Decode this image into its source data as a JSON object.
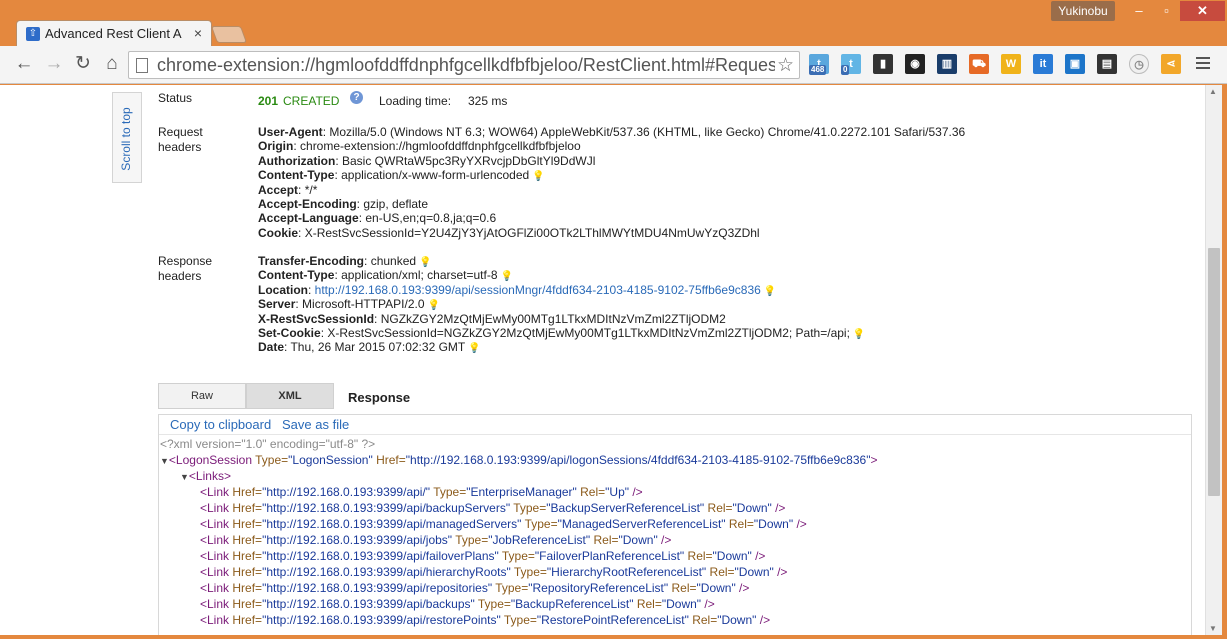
{
  "window": {
    "user": "Yukinobu"
  },
  "tab": {
    "title": "Advanced Rest Client A"
  },
  "toolbar": {
    "url": "chrome-extension://hgmloofddffdnphfgcellkdfbfbjeloo/RestClient.html#Reques",
    "extensions": [
      {
        "icon": "twitter-bird-icon",
        "badge": "468",
        "color": "#5aa7dd"
      },
      {
        "icon": "twitter-bird-icon",
        "badge": "0",
        "color": "#62b5e5"
      },
      {
        "icon": "phone-send-icon",
        "badge": "",
        "color": "#333333"
      },
      {
        "icon": "color-wheel-icon",
        "badge": "",
        "color": "#222222"
      },
      {
        "icon": "bar-chart-icon",
        "badge": "",
        "color": "#1a3d6a"
      },
      {
        "icon": "shopping-cart-icon",
        "badge": "",
        "color": "#e66a26"
      },
      {
        "icon": "w-icon",
        "badge": "",
        "color": "#f0b31a"
      },
      {
        "icon": "it-icon",
        "badge": "",
        "color": "#2a7bd6"
      },
      {
        "icon": "screen-icon",
        "badge": "",
        "color": "#1d75c9"
      },
      {
        "icon": "film-icon",
        "badge": "",
        "color": "#333333"
      },
      {
        "icon": "clock-icon",
        "badge": "",
        "color": "#cccccc"
      },
      {
        "icon": "share-icon",
        "badge": "",
        "color": "#f2a72a"
      }
    ]
  },
  "page": {
    "scroll_to_top": "Scroll to top",
    "status_label": "Status",
    "status_code": "201",
    "status_text": "CREATED",
    "loading_label": "Loading time:",
    "loading_value": "325 ms",
    "request_headers_label": "Request headers",
    "request_headers": [
      {
        "name": "User-Agent",
        "value": "Mozilla/5.0 (Windows NT 6.3; WOW64) AppleWebKit/537.36 (KHTML, like Gecko) Chrome/41.0.2272.101 Safari/537.36",
        "hint": false
      },
      {
        "name": "Origin",
        "value": "chrome-extension://hgmloofddffdnphfgcellkdfbfbjeloo",
        "hint": false
      },
      {
        "name": "Authorization",
        "value": "Basic QWRtaW5pc3RyYXRvcjpDbGltYl9DdWJl",
        "hint": false
      },
      {
        "name": "Content-Type",
        "value": "application/x-www-form-urlencoded",
        "hint": true
      },
      {
        "name": "Accept",
        "value": "*/*",
        "hint": false
      },
      {
        "name": "Accept-Encoding",
        "value": "gzip, deflate",
        "hint": false
      },
      {
        "name": "Accept-Language",
        "value": "en-US,en;q=0.8,ja;q=0.6",
        "hint": false
      },
      {
        "name": "Cookie",
        "value": "X-RestSvcSessionId=Y2U4ZjY3YjAtOGFlZi00OTk2LThlMWYtMDU4NmUwYzQ3ZDhl",
        "hint": false
      }
    ],
    "response_headers_label": "Response headers",
    "response_headers": [
      {
        "name": "Transfer-Encoding",
        "value": "chunked",
        "hint": true,
        "link": false
      },
      {
        "name": "Content-Type",
        "value": "application/xml; charset=utf-8",
        "hint": true,
        "link": false
      },
      {
        "name": "Location",
        "value": "http://192.168.0.193:9399/api/sessionMngr/4fddf634-2103-4185-9102-75ffb6e9c836",
        "hint": true,
        "link": true
      },
      {
        "name": "Server",
        "value": "Microsoft-HTTPAPI/2.0",
        "hint": true,
        "link": false
      },
      {
        "name": "X-RestSvcSessionId",
        "value": "NGZkZGY2MzQtMjEwMy00MTg1LTkxMDItNzVmZml2ZTljODM2",
        "hint": false,
        "link": false
      },
      {
        "name": "Set-Cookie",
        "value": "X-RestSvcSessionId=NGZkZGY2MzQtMjEwMy00MTg1LTkxMDItNzVmZml2ZTljODM2; Path=/api;",
        "hint": true,
        "link": false
      },
      {
        "name": "Date",
        "value": "Thu, 26 Mar 2015 07:02:32 GMT",
        "hint": true,
        "link": false
      }
    ],
    "tabs": [
      "Raw",
      "XML"
    ],
    "response_title": "Response",
    "copy_label": "Copy to clipboard",
    "save_label": "Save as file",
    "xml_decl": "<?xml version=\"1.0\" encoding=\"utf-8\" ?>",
    "logon_session": {
      "type": "LogonSession",
      "href": "http://192.168.0.193:9399/api/logonSessions/4fddf634-2103-4185-9102-75ffb6e9c836"
    },
    "links_tag": "<Links>",
    "links": [
      {
        "href": "http://192.168.0.193:9399/api/",
        "type": "EnterpriseManager",
        "rel": "Up"
      },
      {
        "href": "http://192.168.0.193:9399/api/backupServers",
        "type": "BackupServerReferenceList",
        "rel": "Down"
      },
      {
        "href": "http://192.168.0.193:9399/api/managedServers",
        "type": "ManagedServerReferenceList",
        "rel": "Down"
      },
      {
        "href": "http://192.168.0.193:9399/api/jobs",
        "type": "JobReferenceList",
        "rel": "Down"
      },
      {
        "href": "http://192.168.0.193:9399/api/failoverPlans",
        "type": "FailoverPlanReferenceList",
        "rel": "Down"
      },
      {
        "href": "http://192.168.0.193:9399/api/hierarchyRoots",
        "type": "HierarchyRootReferenceList",
        "rel": "Down"
      },
      {
        "href": "http://192.168.0.193:9399/api/repositories",
        "type": "RepositoryReferenceList",
        "rel": "Down"
      },
      {
        "href": "http://192.168.0.193:9399/api/backups",
        "type": "BackupReferenceList",
        "rel": "Down"
      },
      {
        "href": "http://192.168.0.193:9399/api/restorePoints",
        "type": "RestorePointReferenceList",
        "rel": "Down"
      }
    ]
  }
}
